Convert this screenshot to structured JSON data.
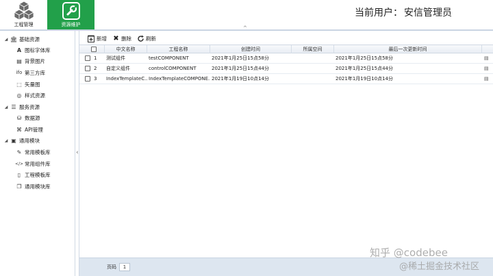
{
  "topbar": {
    "buttons": [
      {
        "label": "工程管理",
        "icon": "cubes-icon"
      },
      {
        "label": "资源维护",
        "icon": "wrench-icon"
      }
    ],
    "user_label": "当前用户：",
    "user_name": "安信管理员",
    "collapse_glyph": "^",
    "accent": "#22a04a"
  },
  "sidebar": {
    "collapse_glyph": "‹",
    "items": [
      {
        "label": "基础资源",
        "level": 0,
        "icon": "bank-icon"
      },
      {
        "label": "图标字体库",
        "level": 1,
        "icon": "font-icon"
      },
      {
        "label": "背景图片",
        "level": 1,
        "icon": "image-icon"
      },
      {
        "label": "第三方库",
        "level": 1,
        "icon": "info-icon"
      },
      {
        "label": "矢量图",
        "level": 1,
        "icon": "vector-icon"
      },
      {
        "label": "样式资源",
        "level": 1,
        "icon": "eye-icon"
      },
      {
        "label": "服务资源",
        "level": 0,
        "icon": "list-icon"
      },
      {
        "label": "数据源",
        "level": 1,
        "icon": "database-icon"
      },
      {
        "label": "API管理",
        "level": 1,
        "icon": "command-icon"
      },
      {
        "label": "通用模块",
        "level": 0,
        "icon": "module-icon"
      },
      {
        "label": "常用模板库",
        "level": 1,
        "icon": "edit-icon"
      },
      {
        "label": "常用组件库",
        "level": 1,
        "icon": "code-icon"
      },
      {
        "label": "工程模板库",
        "level": 1,
        "icon": "file-icon"
      },
      {
        "label": "通用模块库",
        "level": 1,
        "icon": "copy-icon"
      }
    ]
  },
  "toolbar": {
    "add_label": "新增",
    "delete_label": "删除",
    "refresh_label": "刷新"
  },
  "table": {
    "columns": [
      "中文名称",
      "工程名称",
      "创建时间",
      "所属空间",
      "最后一次更新时间"
    ],
    "rows": [
      {
        "num": "1",
        "cn_name": "测试组件",
        "project_name": "testCOMPONENT",
        "created": "2021年1月25日15点58分",
        "space": "",
        "updated": "2021年1月25日15点58分"
      },
      {
        "num": "2",
        "cn_name": "自定义组件",
        "project_name": "controlCOMPONENT",
        "created": "2021年1月25日15点44分",
        "space": "",
        "updated": "2021年1月25日15点44分"
      },
      {
        "num": "3",
        "cn_name": "IndexTemplateC...",
        "project_name": "IndexTemplateCOMPONE...",
        "created": "2021年1月19日10点14分",
        "space": "",
        "updated": "2021年1月19日10点14分"
      }
    ]
  },
  "footer": {
    "page_label": "页码",
    "page_value": "1"
  },
  "watermark": {
    "line1": "知乎 @codebee",
    "line2": "@稀土掘金技术社区"
  }
}
